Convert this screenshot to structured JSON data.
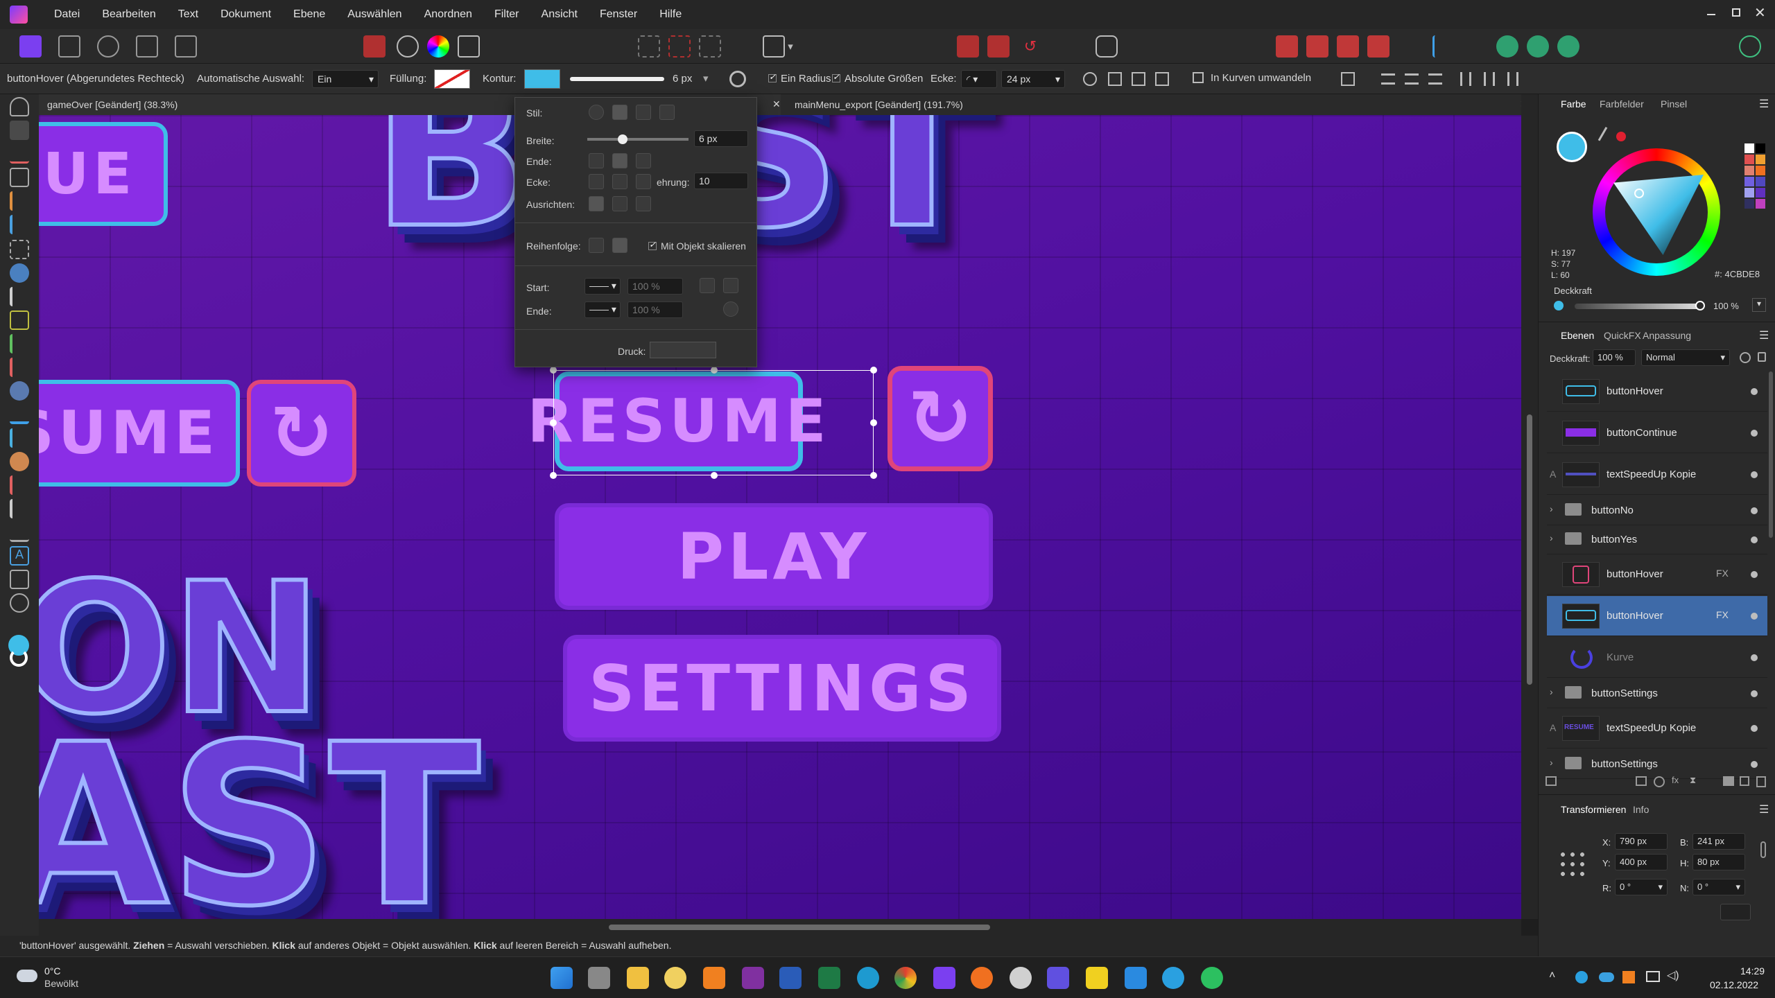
{
  "menu": {
    "logo_icon": "affinity-designer-logo-icon",
    "items": [
      "Datei",
      "Bearbeiten",
      "Text",
      "Dokument",
      "Ebene",
      "Auswählen",
      "Anordnen",
      "Filter",
      "Ansicht",
      "Fenster",
      "Hilfe"
    ]
  },
  "context": {
    "selection_label": "buttonHover (Abgerundetes Rechteck)",
    "auto_select_label": "Automatische Auswahl:",
    "auto_select_value": "Ein",
    "fill_label": "Füllung:",
    "stroke_label": "Kontur:",
    "stroke_width": "6 px",
    "one_radius": "Ein Radius",
    "absolute_sizes": "Absolute Größen",
    "corner_label": "Ecke:",
    "corner_value": "24 px",
    "convert_curves": "In Kurven umwandeln",
    "stroke_color": "#3fbde8"
  },
  "doctabs": {
    "active": "gameOver [Geändert] (38.3%)",
    "other": "mainMenu_export [Geändert] (191.7%)"
  },
  "canvas": {
    "buttons": {
      "resume": "RESUME",
      "play": "PLAY",
      "settings": "SETTINGS"
    },
    "left_resume": "SUME",
    "left_continue": "UE",
    "bg_word_top": "BAST",
    "bg_word_left1": "ON",
    "bg_word_left2": "AST",
    "colors": {
      "button": "#8a2ee6",
      "hover_stroke": "#3fbde8",
      "red_stroke": "#e0457a",
      "text": "#d68cff"
    }
  },
  "stroke_panel": {
    "style_label": "Stil:",
    "width_label": "Breite:",
    "width_value": "6 px",
    "cap_label": "Ende:",
    "join_label": "Ecke:",
    "miter_label": "ehrung:",
    "miter_value": "10",
    "align_label": "Ausrichten:",
    "order_label": "Reihenfolge:",
    "scale_with_object": "Mit Objekt skalieren",
    "start_label": "Start:",
    "start_percent": "100 %",
    "end_label": "Ende:",
    "end_percent": "100 %",
    "pressure_label": "Druck:"
  },
  "color_panel": {
    "tabs": [
      "Farbe",
      "Farbfelder",
      "Pinsel"
    ],
    "h": "H: 197",
    "s": "S: 77",
    "l": "L: 60",
    "hex": "4CBDE8",
    "opacity_label": "Deckkraft",
    "opacity_value": "100 %",
    "swatches": [
      "#ffffff",
      "#000000",
      "#e05050",
      "#f0a030",
      "#e08070",
      "#f07020",
      "#7060e0",
      "#5048c0",
      "#a0a0f0",
      "#6030c0",
      "#303060",
      "#c040c0"
    ]
  },
  "layers_panel": {
    "tabs": [
      "Ebenen",
      "QuickFX",
      "Anpassung"
    ],
    "opacity_label": "Deckkraft:",
    "opacity_value": "100 %",
    "blend_mode": "Normal",
    "layers": [
      {
        "name": "buttonHover",
        "type": "rect"
      },
      {
        "name": "buttonContinue",
        "type": "image"
      },
      {
        "name": "textSpeedUp Kopie",
        "type": "text"
      },
      {
        "name": "buttonNo",
        "type": "folder"
      },
      {
        "name": "buttonYes",
        "type": "folder"
      },
      {
        "name": "buttonHover",
        "type": "rect-red",
        "fx": "FX"
      },
      {
        "name": "buttonHover",
        "type": "rect-selected",
        "fx": "FX"
      },
      {
        "name": "Kurve",
        "type": "curve"
      },
      {
        "name": "buttonSettings",
        "type": "folder"
      },
      {
        "name": "textSpeedUp Kopie",
        "type": "text-resume",
        "thumb_text": "RESUME"
      },
      {
        "name": "buttonSettings",
        "type": "folder"
      }
    ]
  },
  "transform_panel": {
    "tabs": [
      "Transformieren",
      "Info"
    ],
    "x_label": "X:",
    "x": "790 px",
    "y_label": "Y:",
    "y": "400 px",
    "w_label": "B:",
    "w": "241 px",
    "h_label": "H:",
    "h": "80 px",
    "r_label": "R:",
    "r": "0 °",
    "n_label": "N:",
    "n": "0 °"
  },
  "status": {
    "text_a": "'buttonHover' ausgewählt. ",
    "b1": "Ziehen",
    "text_b": " = Auswahl verschieben. ",
    "b2": "Klick",
    "text_c": " auf anderes Objekt = Objekt auswählen. ",
    "b3": "Klick",
    "text_d": " auf leeren Bereich = Auswahl aufheben."
  },
  "taskbar": {
    "weather_temp": "0°C",
    "weather_desc": "Bewölkt",
    "time": "14:29",
    "date": "02.12.2022"
  }
}
